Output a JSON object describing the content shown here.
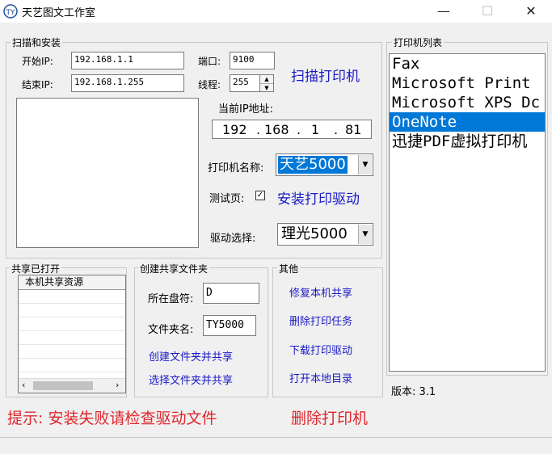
{
  "window": {
    "title": "天艺图文工作室",
    "min_glyph": "—",
    "max_glyph": "☐",
    "close_glyph": "✕"
  },
  "scan": {
    "legend": "扫描和安装",
    "start_ip_label": "开始IP:",
    "start_ip": "192.168.1.1",
    "end_ip_label": "结束IP:",
    "end_ip": "192.168.1.255",
    "port_label": "端口:",
    "port": "9100",
    "threads_label": "线程:",
    "threads": "255",
    "scan_button": "扫描打印机",
    "current_ip_label": "当前IP地址:",
    "ip_octets": [
      "192",
      "168",
      "1",
      "81"
    ],
    "printer_name_label": "打印机名称:",
    "printer_name": "天艺5000",
    "test_page_label": "测试页:",
    "test_page_checked": "✓",
    "install_driver_button": "安装打印驱动",
    "driver_select_label": "驱动选择:",
    "driver_select": "理光5000"
  },
  "shared": {
    "legend": "共享已打开",
    "column_header": "本机共享资源"
  },
  "create_share": {
    "legend": "创建共享文件夹",
    "drive_label": "所在盘符:",
    "drive": "D",
    "folder_label": "文件夹名:",
    "folder": "TY5000",
    "create_button": "创建文件夹并共享",
    "select_button": "选择文件夹并共享"
  },
  "other": {
    "legend": "其他",
    "buttons": [
      "修复本机共享",
      "删除打印任务",
      "下载打印驱动",
      "打开本地目录"
    ]
  },
  "printer_list": {
    "legend": "打印机列表",
    "items": [
      "Fax",
      "Microsoft Print",
      "Microsoft XPS Dc",
      "OneNote",
      "迅捷PDF虚拟打印机"
    ],
    "selected_index": 3
  },
  "version": "版本: 3.1",
  "hint": "提示: 安装失败请检查驱动文件",
  "delete_printer_button": "删除打印机",
  "colors": {
    "link": "#1a1ac8",
    "hint_red": "#e0262b",
    "selection": "#0078d7"
  }
}
